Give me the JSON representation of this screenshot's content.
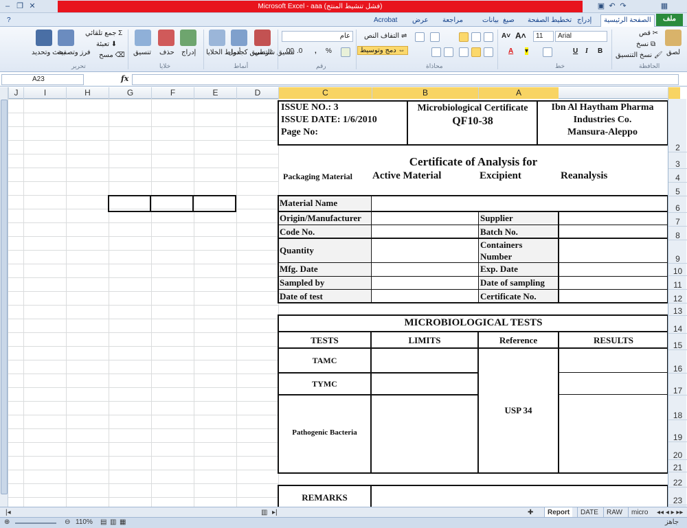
{
  "window": {
    "title": "Microsoft Excel - aaa (فشل تنشيط المنتج)"
  },
  "ribbon_tabs": [
    "ملف",
    "الصفحة الرئيسية",
    "إدراج",
    "تخطيط الصفحة",
    "صيغ",
    "بيانات",
    "مراجعة",
    "عرض",
    "Acrobat"
  ],
  "ribbon": {
    "clipboard": {
      "group": "الحافظة",
      "paste": "لصق",
      "cut": "قص",
      "copy": "نسخ",
      "format_painter": "نسخ التنسيق"
    },
    "font": {
      "group": "خط",
      "name": "Arial",
      "size": "11",
      "bold": "B",
      "italic": "I",
      "underline": "U"
    },
    "alignment": {
      "group": "محاذاة",
      "wrap": "التفاف النص",
      "merge": "دمج وتوسيط"
    },
    "number": {
      "group": "رقم",
      "format": "عام",
      "percent": "%",
      "comma": ","
    },
    "styles": {
      "group": "أنماط",
      "conditional": "تنسيق شرطي",
      "as_table": "التنسيق كجدول",
      "cell_styles": "أنماط الخلايا"
    },
    "cells": {
      "group": "خلايا",
      "insert": "إدراج",
      "delete": "حذف",
      "format": "تنسيق"
    },
    "editing": {
      "group": "تحرير",
      "autosum": "جمع تلقائي",
      "fill": "تعبئة",
      "clear": "مسح",
      "sort": "فرز وتصفية",
      "find": "بحث وتحديد"
    }
  },
  "formula_bar": {
    "name_box": "A23",
    "fx": "fx",
    "formula": ""
  },
  "columns": [
    {
      "label": "J",
      "sel": false
    },
    {
      "label": "I",
      "sel": false
    },
    {
      "label": "H",
      "sel": false
    },
    {
      "label": "G",
      "sel": false
    },
    {
      "label": "F",
      "sel": false
    },
    {
      "label": "E",
      "sel": false
    },
    {
      "label": "D",
      "sel": false
    },
    {
      "label": "C",
      "sel": true
    },
    {
      "label": "B",
      "sel": true
    },
    {
      "label": "A",
      "sel": true
    }
  ],
  "rows": [
    "2",
    "3",
    "4",
    "5",
    "6",
    "7",
    "8",
    "9",
    "10",
    "11",
    "12",
    "13",
    "14",
    "15",
    "16",
    "17",
    "18",
    "19",
    "20",
    "21",
    "22",
    "23"
  ],
  "sheet": {
    "header": {
      "issue_no": "ISSUE NO.: 3",
      "issue_date": "ISSUE DATE: 1/6/2010",
      "page_no": "Page No:",
      "cert_title": "Microbiological Certificate",
      "cert_code": "QF10-38",
      "company_1": "Ibn Al Haytham  Pharma",
      "company_2": "Industries Co.",
      "company_3": "Mansura-Aleppo"
    },
    "coa_title": "Certificate of Analysis for",
    "material_types": {
      "packaging": "Packaging Material",
      "active": "Active Material",
      "excipient": "Excipient",
      "reanalysis": "Reanalysis"
    },
    "info_left": [
      "Material Name",
      "Origin/Manufacturer",
      "Code No.",
      "Quantity",
      "Mfg. Date",
      "Sampled by",
      "Date of test"
    ],
    "info_right": {
      "supplier": "Supplier",
      "batch": "Batch No.",
      "containers_1": "Containers",
      "containers_2": "Number",
      "exp": "Exp. Date",
      "sampling": "Date of sampling",
      "certificate": "Certificate  No."
    },
    "micro": {
      "title": "MICROBIOLOGICAL TESTS",
      "headers": {
        "tests": "TESTS",
        "limits": "LIMITS",
        "reference": "Reference",
        "results": "RESULTS"
      },
      "tests": [
        "TAMC",
        "TYMC",
        "Pathogenic Bacteria"
      ],
      "reference_value": "USP 34"
    },
    "remarks": "REMARKS"
  },
  "sheet_tabs": [
    "Report",
    "DATE",
    "RAW",
    "micro"
  ],
  "active_sheet": "Report",
  "status": {
    "ready": "جاهز",
    "zoom": "110%"
  }
}
